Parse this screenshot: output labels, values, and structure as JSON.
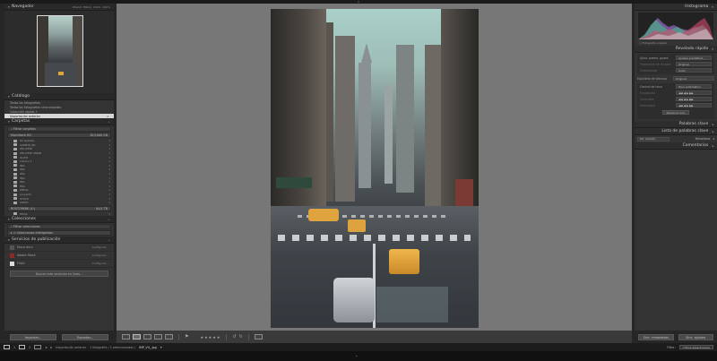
{
  "top": {
    "collapse_arrow": "▾"
  },
  "left": {
    "navigator": {
      "title": "Navegador",
      "zoom_opts": [
        "PASAR",
        "ENCAJ",
        "100%",
        "200%"
      ]
    },
    "catalog": {
      "title": "Catálogo",
      "items": [
        {
          "name": "Todas las fotografías",
          "count": ""
        },
        {
          "name": "Todas las fotografías sincronizadas",
          "count": ""
        },
        {
          "name": "Colección rápida +",
          "count": ""
        },
        {
          "name": "Importación anterior",
          "count": "1"
        }
      ]
    },
    "folders": {
      "title": "Carpetas",
      "filter_label": "Filtrar carpetas",
      "volume1": {
        "name": "Macintosh HD",
        "size": "82/1000 GB"
      },
      "items": [
        {
          "name": "00 website",
          "count": "1"
        },
        {
          "name": "SCENTE_8D",
          "count": "1"
        },
        {
          "name": "DELIVERY",
          "count": "1"
        },
        {
          "name": "DELIVERY SNNN",
          "count": "1"
        },
        {
          "name": "GLOW",
          "count": "1"
        },
        {
          "name": "Interior 1",
          "count": "1"
        },
        {
          "name": "IMG",
          "count": "1"
        },
        {
          "name": "IMG",
          "count": "4"
        },
        {
          "name": "IMG",
          "count": "3"
        },
        {
          "name": "IMG",
          "count": "1"
        },
        {
          "name": "IMG",
          "count": "1"
        },
        {
          "name": "IMG",
          "count": "1"
        },
        {
          "name": "MEDIA",
          "count": "1"
        },
        {
          "name": "proyecto",
          "count": "1"
        },
        {
          "name": "STOCK",
          "count": "3"
        },
        {
          "name": "VIDEO",
          "count": "1"
        }
      ],
      "volume2": {
        "name": "ROSTOPARK (X:)",
        "size": "64/1 TB"
      },
      "items2": [
        {
          "name": "HEOR",
          "count": "1"
        }
      ]
    },
    "collections": {
      "title": "Colecciones",
      "filter_label": "Filtrar colecciones",
      "smart": "Colecciones inteligentes"
    },
    "publish": {
      "title": "Servicios de publicación",
      "items": [
        {
          "name": "Disco duro",
          "action": "Configurar..."
        },
        {
          "name": "Adobe Stock",
          "action": "Configurar..."
        },
        {
          "name": "Flickr",
          "action": "Configurar..."
        }
      ],
      "more_button": "Buscar más servicios en línea..."
    },
    "import_button": "Importar...",
    "export_button": "Exportar..."
  },
  "right": {
    "histogram": {
      "title": "Histograma",
      "original_label": "Fotografía original"
    },
    "quick_develop": {
      "title": "Revelado rápido",
      "preset_label": "Ajust. preest. guard.",
      "preset_value": "Ajustes predefinid...",
      "crop_label": "Proporción de recorte",
      "crop_value": "Original",
      "treatment_label": "Tratamiento",
      "treatment_value": "Color",
      "wb_label": "Equilibrio de blancos",
      "wb_value": "Original",
      "tone_label": "Control de tono",
      "tone_auto": "Tono automático",
      "exposure_label": "Exposición",
      "contrast_label": "Contraste",
      "vibrance_label": "Intensidad",
      "reset_button": "Restaurar todo"
    },
    "keywords": {
      "title": "Palabras clave"
    },
    "keyword_list": {
      "title": "Lista de palabras clave"
    },
    "metadata": {
      "title": "Metadatos",
      "preset": "Por omisión"
    },
    "comments": {
      "title": "Comentarios"
    },
    "sync_meta_button": "Sinc. metadatos",
    "sync_settings_button": "Sinc. ajustes"
  },
  "toolbar": {
    "stars": "★★★★★"
  },
  "filmstrip": {
    "page1": "1",
    "page2": "2",
    "source": "Importación anterior",
    "info": "1 fotografía / 1 seleccionadas /",
    "filename": "IMP_V4_.jpg",
    "filter_label": "Filtro :",
    "filter_value": "Filtros desactivados"
  },
  "colors": {
    "panel": "#333333",
    "canvas": "#777777",
    "selected_row": "#d6d6d6",
    "taxi": "#e0a53a"
  }
}
